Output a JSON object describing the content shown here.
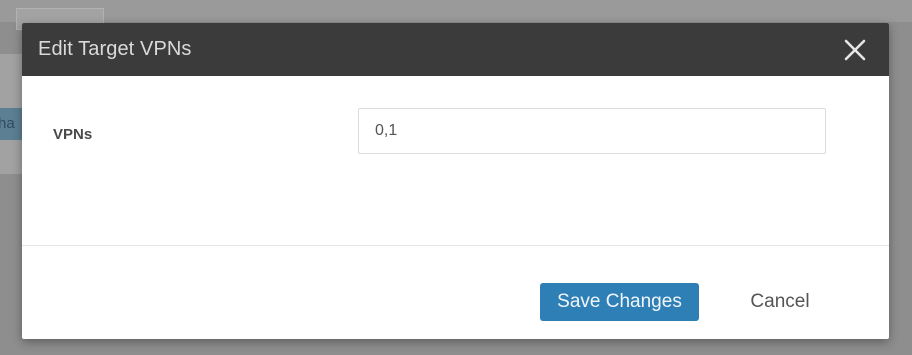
{
  "background": {
    "partial_tab_text": "ha"
  },
  "modal": {
    "title": "Edit Target VPNs",
    "close_icon": "close-icon",
    "fields": {
      "vpns": {
        "label": "VPNs",
        "value": "0,1"
      }
    },
    "footer": {
      "save_label": "Save Changes",
      "cancel_label": "Cancel"
    }
  },
  "colors": {
    "header_bg": "#3b3b3b",
    "primary_button": "#2f7fb7",
    "overlay": "#8e8e8e"
  }
}
